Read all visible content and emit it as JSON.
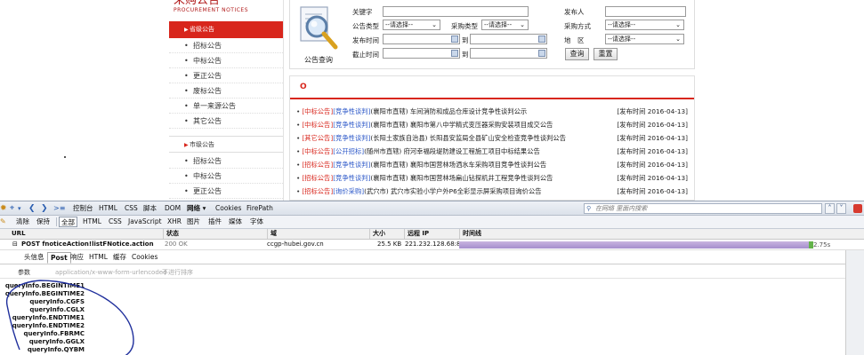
{
  "site": {
    "brand_cn": "采购公告",
    "brand_en": "PROCUREMENT NOTICES",
    "province_label": "省级公告",
    "city_label": "市级公告",
    "province_items": [
      "招标公告",
      "中标公告",
      "更正公告",
      "废标公告",
      "单一来源公告",
      "其它公告"
    ],
    "city_items": [
      "招标公告",
      "中标公告",
      "更正公告"
    ],
    "bullet": "•",
    "arrow": "▶"
  },
  "search": {
    "title": "公告查询",
    "labels": {
      "keyword": "关键字",
      "publisher": "发布人",
      "type": "公告类型",
      "ptype": "采购类型",
      "pmethod": "采购方式",
      "ptime": "发布时间",
      "to1": "到",
      "area": "地　区",
      "deadline": "截止时间",
      "to2": "到"
    },
    "select_default": "--请选择--",
    "query_button": "查询",
    "reset_button": "重置"
  },
  "notices": {
    "heading": "O",
    "rows": [
      {
        "tag1": "[中标公告]",
        "tag2": "[竞争性谈判]",
        "title": "(襄阳市直辖) 车间消防和成品仓库设计竞争性谈判公示",
        "date": "[发布时间 2016-04-13]"
      },
      {
        "tag1": "[中标公告]",
        "tag2": "[竞争性谈判]",
        "title": "(襄阳市直辖) 襄阳市第八中学精式变压器采购安装项目成交公告",
        "date": "[发布时间 2016-04-13]"
      },
      {
        "tag1": "[其它公告]",
        "tag2": "[竞争性谈判]",
        "title": "(长阳土家族自治县) 长阳县安监局全县矿山安全检查竞争性谈判公告",
        "date": "[发布时间 2016-04-13]"
      },
      {
        "tag1": "[中标公告]",
        "tag2": "[公开招标]",
        "title": "(随州市直辖) 府河幸福段堤防建设工程施工项目中标结果公告",
        "date": "[发布时间 2016-04-13]"
      },
      {
        "tag1": "[招标公告]",
        "tag2": "[竞争性谈判]",
        "title": "(襄阳市直辖) 襄阳市国营林场洒水车采购项目竞争性谈判公告",
        "date": "[发布时间 2016-04-13]"
      },
      {
        "tag1": "[招标公告]",
        "tag2": "[竞争性谈判]",
        "title": "(襄阳市直辖) 襄阳市国营林场扁山钻探机井工程竞争性谈判公告",
        "date": "[发布时间 2016-04-13]"
      },
      {
        "tag1": "[招标公告]",
        "tag2": "[询价采购]",
        "title": "(武穴市) 武穴市实验小学户外P6全彩显示屏采购项目询价公告",
        "date": "[发布时间 2016-04-13]"
      }
    ]
  },
  "firebug": {
    "toolbar": {
      "console": "控制台",
      "html": "HTML",
      "css": "CSS",
      "script": "脚本",
      "dom": "DOM",
      "net": "网络 ▾",
      "cookies": "Cookies",
      "firepath": "FirePath",
      "search_placeholder": "在网络 里面内搜索"
    },
    "filters": {
      "clear": "清除",
      "persist": "保持",
      "all": "全部",
      "html": "HTML",
      "css": "CSS",
      "js": "JavaScript",
      "xhr": "XHR",
      "images": "图片",
      "plugins": "插件",
      "media": "媒体",
      "fonts": "字体"
    },
    "columns": {
      "url": "URL",
      "status": "状态",
      "domain": "域",
      "size": "大小",
      "remote_ip": "远程 IP",
      "timeline": "时间线"
    },
    "request": {
      "toggle": "⊟",
      "url": "POST fnoticeAction!listFNotice.action",
      "status": "200 OK",
      "domain": "ccgp-hubei.gov.cn",
      "size": "25.5 KB",
      "remote_ip": "221.232.128.68:80",
      "time": "2.75s",
      "total_fraction": 0.985
    },
    "request_tabs": [
      "头信息",
      "Post",
      "响应",
      "HTML",
      "缓存",
      "Cookies"
    ],
    "params_header": {
      "label": "参数",
      "content_type": "application/x-www-form-urlencoded",
      "sort": "不进行排序"
    },
    "params": [
      "queryInfo.BEGINTIME1",
      "queryInfo.BEGINTIME2",
      "queryInfo.CGFS",
      "queryInfo.CGLX",
      "queryInfo.ENDTIME1",
      "queryInfo.ENDTIME2",
      "queryInfo.FBRMC",
      "queryInfo.GGLX",
      "queryInfo.QYBM"
    ]
  },
  "colors": {
    "brand_red": "#d8261c",
    "link_blue": "#2b57c8",
    "annotation": "#1f2f9c"
  },
  "icons": [
    "magnifier-document-icon",
    "inspect-icon",
    "back-icon",
    "forward-icon",
    "console-icon",
    "search-icon",
    "close-icon"
  ]
}
